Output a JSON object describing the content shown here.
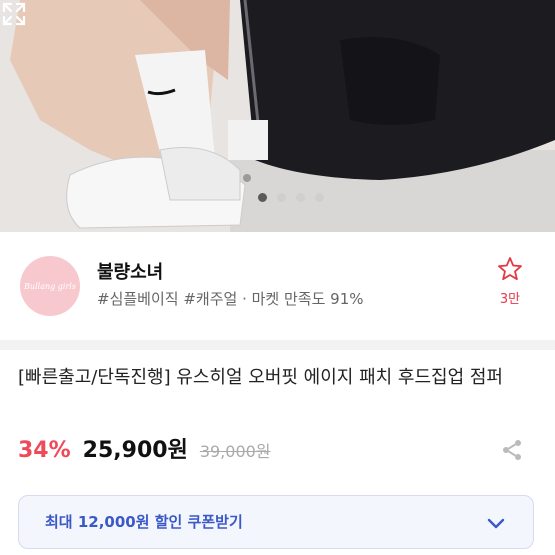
{
  "carousel": {
    "total_dots": 4,
    "active_index": 0
  },
  "shop": {
    "avatar_text": "Bullang girls",
    "name": "불량소녀",
    "tags": "#심플베이직 #캐주얼 · 마켓 만족도 91%",
    "favorite_count": "3만"
  },
  "product": {
    "title": "[빠른출고/단독진행] 유스히얼 오버핏 에이지 패치 후드집업 점퍼",
    "discount": "34%",
    "price": "25,900원",
    "original_price": "39,000원"
  },
  "coupon": {
    "label": "최대 12,000원 할인 쿠폰받기"
  },
  "colors": {
    "accent_red": "#ef4a5a",
    "coupon_blue": "#3a59c7"
  }
}
